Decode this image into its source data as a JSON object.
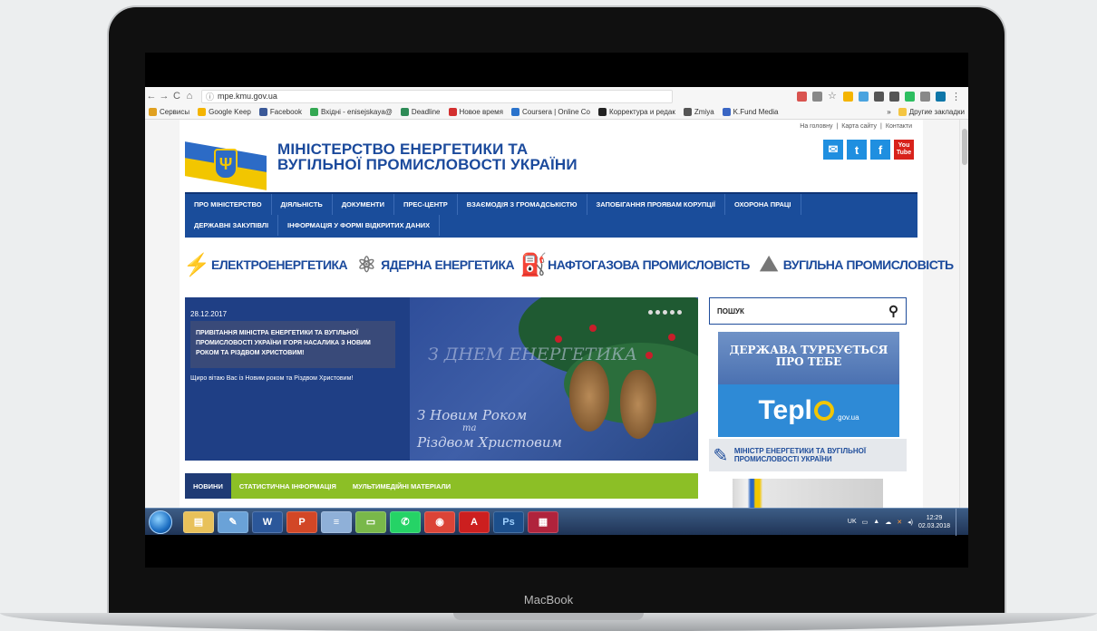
{
  "device": {
    "brand": "MacBook"
  },
  "browser": {
    "url": "mpe.kmu.gov.ua",
    "nav": {
      "back": "←",
      "forward": "→",
      "reload": "C",
      "home": "⌂",
      "info": "ⓘ"
    },
    "bookmarks": [
      {
        "label": "Сервисы",
        "color": "#e0a020"
      },
      {
        "label": "Google Keep",
        "color": "#f4b400"
      },
      {
        "label": "Facebook",
        "color": "#3b5998"
      },
      {
        "label": "Вхідні - enisejskaya@",
        "color": "#34a853"
      },
      {
        "label": "Deadline",
        "color": "#2e8b57"
      },
      {
        "label": "Новое время",
        "color": "#d32f2f"
      },
      {
        "label": "Coursera | Online Co",
        "color": "#2a73cc"
      },
      {
        "label": "Корректура и редак",
        "color": "#222222"
      },
      {
        "label": "Zmiya",
        "color": "#555555"
      },
      {
        "label": "K.Fund Media",
        "color": "#3a66c4"
      }
    ],
    "bookmarks_more": "»",
    "other_bookmarks": "Другие закладки"
  },
  "site": {
    "top_links": [
      "На головну",
      "Карта сайту",
      "Контакти"
    ],
    "top_links_sep": "|",
    "title_line1": "МІНІСТЕРСТВО ЕНЕРГЕТИКИ ТА",
    "title_line2": "ВУГІЛЬНОЇ ПРОМИСЛОВОСТІ УКРАЇНИ",
    "social": {
      "mail": {
        "glyph": "✉",
        "color": "#1f8fe0"
      },
      "twitter": {
        "glyph": "t",
        "color": "#1f8fe0"
      },
      "facebook": {
        "glyph": "f",
        "color": "#1f8fe0"
      },
      "youtube": {
        "glyph": "You Tube",
        "color": "#d8221b"
      }
    },
    "nav_row1": [
      "ПРО МІНІСТЕРСТВО",
      "ДІЯЛЬНІСТЬ",
      "ДОКУМЕНТИ",
      "ПРЕС-ЦЕНТР",
      "ВЗАЄМОДІЯ З ГРОМАДСЬКІСТЮ",
      "ЗАПОБІГАННЯ ПРОЯВАМ КОРУПЦІЇ",
      "ОХОРОНА ПРАЦІ"
    ],
    "nav_row2": [
      "ДЕРЖАВНІ ЗАКУПІВЛІ",
      "ІНФОРМАЦІЯ У ФОРМІ ВІДКРИТИХ ДАНИХ"
    ],
    "sectors": [
      {
        "label": "ЕЛЕКТРОЕНЕРГЕТИКА",
        "icon": "power-tower-icon",
        "glyph": "⚡"
      },
      {
        "label": "ЯДЕРНА ЕНЕРГЕТИКА",
        "icon": "atom-icon",
        "glyph": "⚛"
      },
      {
        "label": "НАФТОГАЗОВА ПРОМИСЛОВІСТЬ",
        "icon": "oil-pump-icon",
        "glyph": "⛽"
      },
      {
        "label": "ВУГІЛЬНА ПРОМИСЛОВІСТЬ",
        "icon": "coal-pile-icon",
        "glyph": "⛰"
      }
    ],
    "slide": {
      "date": "28.12.2017",
      "caption": "ПРИВІТАННЯ МІНІСТРА ЕНЕРГЕТИКИ ТА ВУГІЛЬНОЇ ПРОМИСЛОВОСТІ УКРАЇНИ ІГОРЯ НАСАЛИКА З НОВИМ РОКОМ ТА РІЗДВОМ ХРИСТОВИМ!",
      "text": "Щиро вітаю Вас із Новим роком та Різдвом Христовим!",
      "image_greeting1": "З ДНЕМ ЕНЕРГЕТИКА",
      "image_greeting2": "З Новим Роком",
      "image_greeting3": "та",
      "image_greeting4": "Різдвом Христовим",
      "dots": 5
    },
    "tabs": [
      "НОВИНИ",
      "СТАТИСТИЧНА ІНФОРМАЦІЯ",
      "МУЛЬТИМЕДІЙНІ МАТЕРІАЛИ"
    ],
    "search": {
      "placeholder": "ПОШУК",
      "icon": "search-icon"
    },
    "banner_state": "ДЕРЖАВА ТУРБУЄТЬСЯ ПРО ТЕБЕ",
    "banner_teplo": {
      "text": "Tepl",
      "domain": ".gov.ua"
    },
    "minister_label": "МІНІСТР ЕНЕРГЕТИКИ ТА ВУГІЛЬНОЇ ПРОМИСЛОВОСТІ УКРАЇНИ"
  },
  "taskbar": {
    "apps": [
      {
        "name": "explorer",
        "glyph": "▤",
        "color": "#e8c15a"
      },
      {
        "name": "paint",
        "glyph": "✎",
        "color": "#6aa2d8"
      },
      {
        "name": "word",
        "glyph": "W",
        "color": "#2b579a"
      },
      {
        "name": "powerpoint",
        "glyph": "P",
        "color": "#d24726"
      },
      {
        "name": "notepad",
        "glyph": "≡",
        "color": "#8fb0d8"
      },
      {
        "name": "folder",
        "glyph": "▭",
        "color": "#79b84a"
      },
      {
        "name": "whatsapp",
        "glyph": "✆",
        "color": "#25d366"
      },
      {
        "name": "chrome",
        "glyph": "◉",
        "color": "#db4437"
      },
      {
        "name": "acrobat",
        "glyph": "A",
        "color": "#cc1f1f"
      },
      {
        "name": "photoshop",
        "glyph": "Ps",
        "color": "#1c4f8c"
      },
      {
        "name": "flag-app",
        "glyph": "▦",
        "color": "#b0233c"
      }
    ],
    "lang": "UK",
    "time": "12:29",
    "date": "02.03.2018"
  }
}
